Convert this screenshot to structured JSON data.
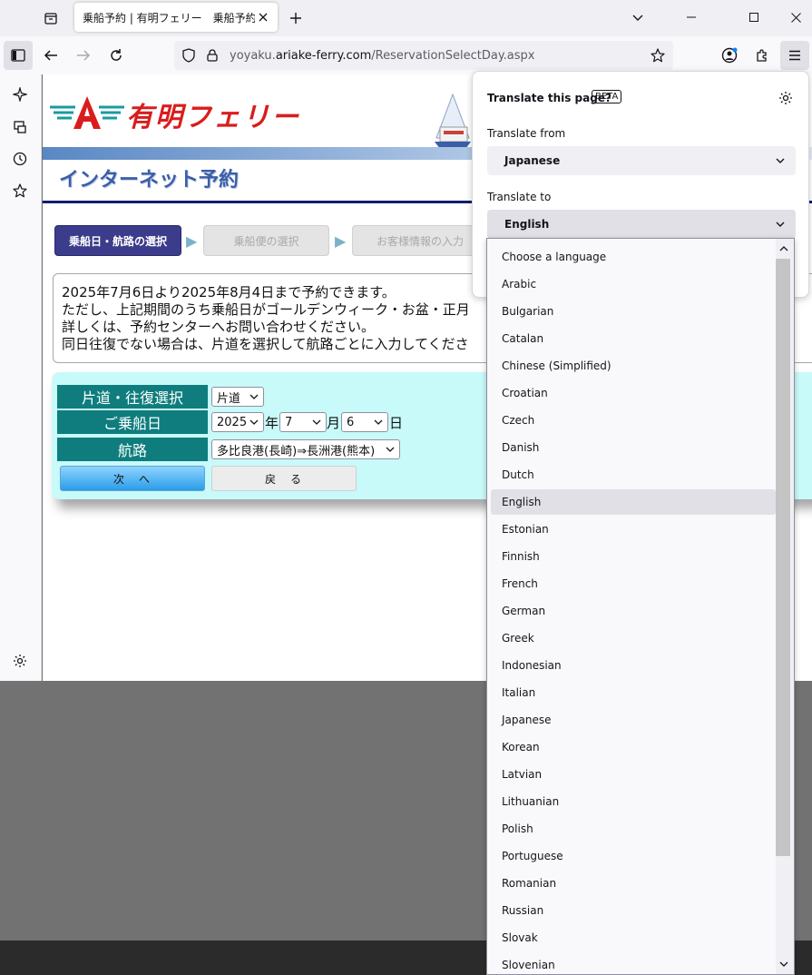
{
  "browser": {
    "tab_title": "乗船予約 | 有明フェリー　乗船予約",
    "url_prefix": "yoyaku.",
    "url_host": "ariake-ferry.com",
    "url_path": "/ReservationSelectDay.aspx"
  },
  "page": {
    "logo_text": "有明フェリー",
    "subtitle": "インターネット予約",
    "steps": [
      "乗船日・航路の選択",
      "乗船便の選択",
      "お客様情報の入力"
    ],
    "notice_lines": [
      "2025年7月6日より2025年8月4日まで予約できます。",
      "ただし、上記期間のうち乗船日がゴールデンウィーク・お盆・正月",
      "詳しくは、予約センターへお問い合わせください。",
      "同日往復でない場合は、片道を選択して航路ごとに入力してくださ"
    ],
    "form": {
      "trip_label": "片道・往復選択",
      "trip_value": "片道",
      "date_label": "ご乗船日",
      "year_value": "2025",
      "year_suffix": "年",
      "month_value": "7",
      "month_suffix": "月",
      "day_value": "6",
      "day_suffix": "日",
      "route_label": "航路",
      "route_value": "多比良港(長崎)⇒長洲港(熊本)",
      "next_button": "次　へ",
      "back_button": "戻　る"
    }
  },
  "translate_panel": {
    "title": "Translate this page?",
    "badge": "BETA",
    "from_label": "Translate from",
    "from_value": "Japanese",
    "to_label": "Translate to",
    "to_value": "English",
    "languages": [
      "Choose a language",
      "Arabic",
      "Bulgarian",
      "Catalan",
      "Chinese (Simplified)",
      "Croatian",
      "Czech",
      "Danish",
      "Dutch",
      "English",
      "Estonian",
      "Finnish",
      "French",
      "German",
      "Greek",
      "Indonesian",
      "Italian",
      "Japanese",
      "Korean",
      "Latvian",
      "Lithuanian",
      "Polish",
      "Portuguese",
      "Romanian",
      "Russian",
      "Slovak",
      "Slovenian"
    ],
    "selected_language": "English"
  },
  "colors": {
    "accent": "#0061e0",
    "step_active": "#3c3c8c",
    "form_label": "#0f7d7d",
    "form_bg": "#c8fafa",
    "logo_red": "#d91d1d"
  }
}
